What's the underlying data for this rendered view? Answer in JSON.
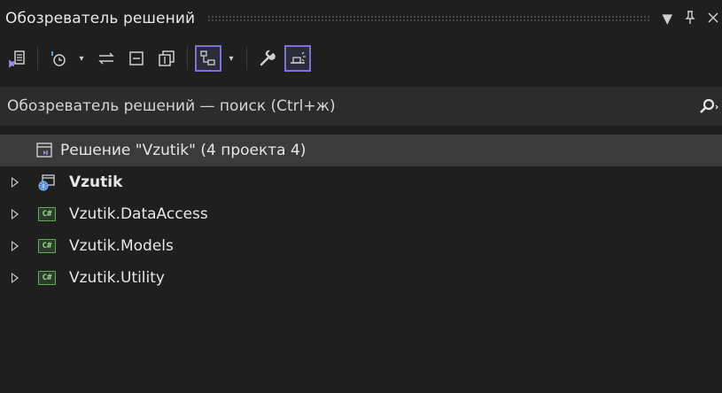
{
  "panel": {
    "title": "Обозреватель решений",
    "title_controls": [
      "dropdown-icon",
      "pin-icon",
      "close-icon"
    ]
  },
  "toolbar": {
    "buttons": [
      {
        "icon": "vs-solution-home-icon"
      },
      {
        "icon": "history-icon"
      },
      {
        "icon": "sync-icon"
      },
      {
        "icon": "collapse-all-icon"
      },
      {
        "icon": "show-all-files-icon"
      },
      {
        "icon": "view-switch-icon",
        "active": true
      },
      {
        "icon": "properties-wrench-icon"
      },
      {
        "icon": "preview-selected-icon",
        "active": true
      }
    ]
  },
  "search": {
    "placeholder": "Обозреватель решений — поиск (Ctrl+ж)"
  },
  "tree": {
    "solution": {
      "label": "Решение \"Vzutik\"  (4 проекта 4)"
    },
    "projects": [
      {
        "label": "Vzutik",
        "icon": "web-project-icon",
        "bold": true
      },
      {
        "label": "Vzutik.DataAccess",
        "icon": "csharp-project-icon",
        "icon_text": "C#"
      },
      {
        "label": "Vzutik.Models",
        "icon": "csharp-project-icon",
        "icon_text": "C#"
      },
      {
        "label": "Vzutik.Utility",
        "icon": "csharp-project-icon",
        "icon_text": "C#"
      }
    ]
  },
  "colors": {
    "background": "#1f1f1f",
    "accent": "#7f6fd9",
    "csharp": "#56b34d",
    "selection": "#3b3b3b"
  }
}
